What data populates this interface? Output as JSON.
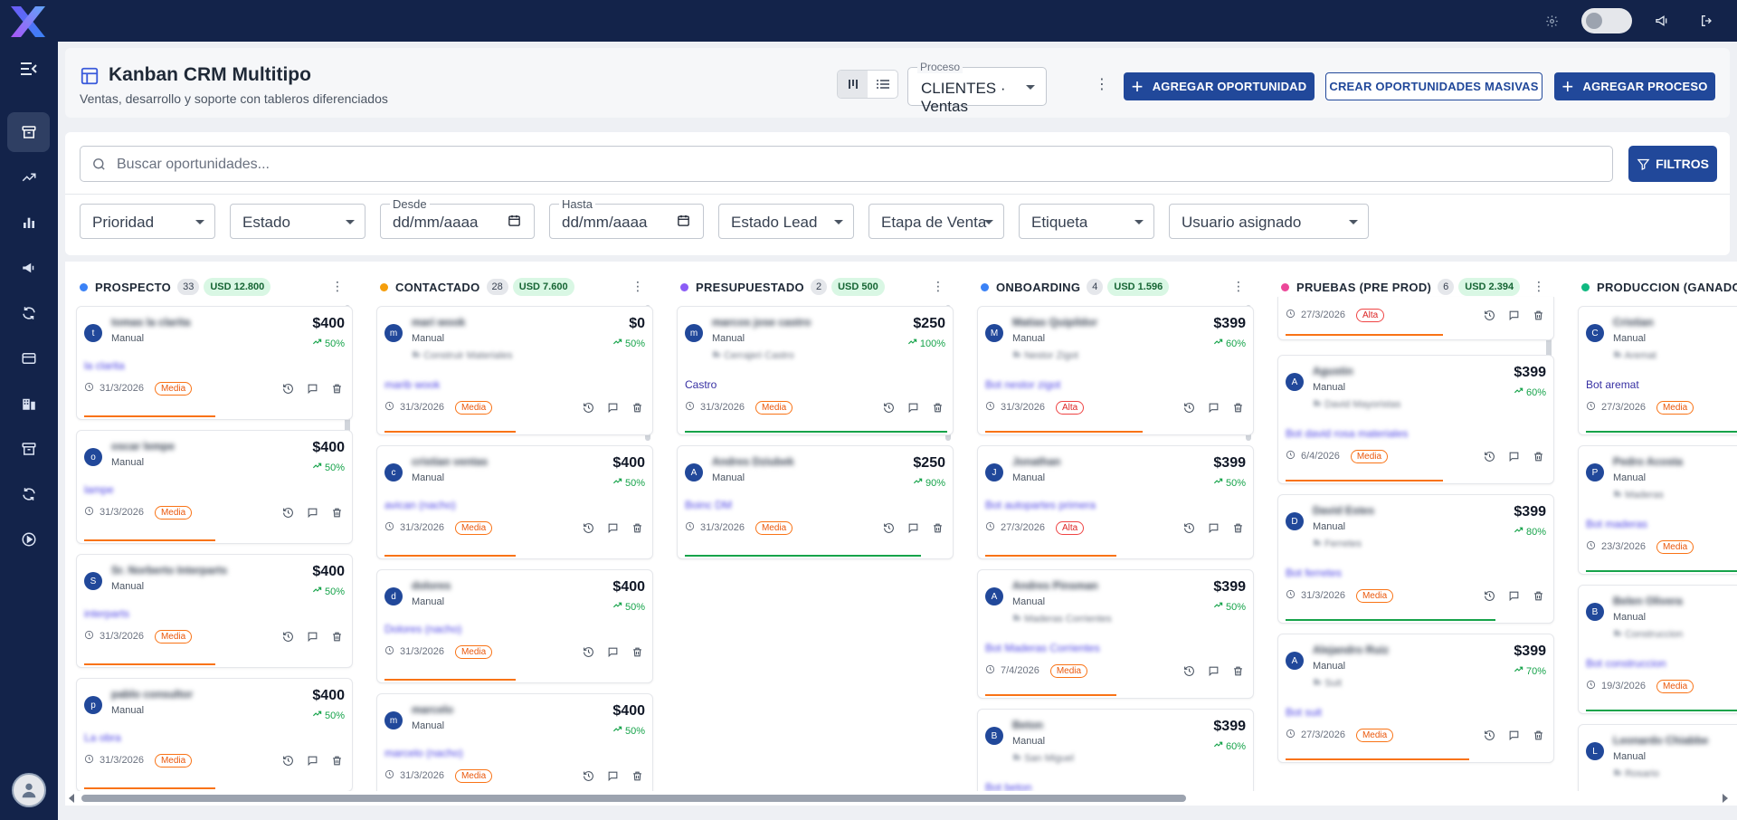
{
  "header": {
    "title": "Kanban CRM Multitipo",
    "subtitle": "Ventas, desarrollo y soporte con tableros diferenciados",
    "process_label": "Proceso",
    "process_value": "CLIENTES · Ventas",
    "add_opportunity": "AGREGAR OPORTUNIDAD",
    "bulk_create": "CREAR OPORTUNIDADES MASIVAS",
    "add_process": "AGREGAR PROCESO"
  },
  "search": {
    "placeholder": "Buscar oportunidades...",
    "filters_label": "FILTROS"
  },
  "filters": {
    "prioridad": "Prioridad",
    "estado": "Estado",
    "desde_label": "Desde",
    "desde_value": "dd/mm/aaaa",
    "hasta_label": "Hasta",
    "hasta_value": "dd/mm/aaaa",
    "estado_lead": "Estado Lead",
    "etapa_venta": "Etapa de Venta",
    "etiqueta": "Etiqueta",
    "usuario": "Usuario asignado"
  },
  "colors": {
    "primary": "#21489a",
    "navy": "#13234a",
    "media": "#ea580c",
    "alta": "#dc2626",
    "success": "#16a34a"
  },
  "columns": [
    {
      "name": "PROSPECTO",
      "count": "33",
      "usd": "USD 12.800",
      "color": "#3b82f6",
      "cards": [
        {
          "initial": "t",
          "name": "tomas la clarita",
          "source": "Manual",
          "amount": "$400",
          "prob": "50%",
          "bot": "la clarita",
          "date": "31/3/2026",
          "priority": "Media",
          "bar_pct": 0.5,
          "bar_color": "#f97316",
          "company": ""
        },
        {
          "initial": "o",
          "name": "oscar lempe",
          "source": "Manual",
          "amount": "$400",
          "prob": "50%",
          "bot": "lampe",
          "date": "31/3/2026",
          "priority": "Media",
          "bar_pct": 0.5,
          "bar_color": "#f97316",
          "company": ""
        },
        {
          "initial": "S",
          "name": "Sr. Norberto Interparts",
          "source": "Manual",
          "amount": "$400",
          "prob": "50%",
          "bot": "interparts",
          "date": "31/3/2026",
          "priority": "Media",
          "bar_pct": 0.5,
          "bar_color": "#f97316",
          "company": ""
        },
        {
          "initial": "p",
          "name": "pablo consultor",
          "source": "Manual",
          "amount": "$400",
          "prob": "50%",
          "bot": "La obra",
          "date": "31/3/2026",
          "priority": "Media",
          "bar_pct": 0.5,
          "bar_color": "#f97316",
          "company": ""
        }
      ]
    },
    {
      "name": "CONTACTADO",
      "count": "28",
      "usd": "USD 7.600",
      "color": "#f59e0b",
      "cards": [
        {
          "initial": "m",
          "name": "mari wook",
          "source": "Manual",
          "amount": "$0",
          "prob": "50%",
          "bot": "marib wook",
          "date": "31/3/2026",
          "priority": "Media",
          "bar_pct": 0.5,
          "bar_color": "#f97316",
          "company": "Construir Materiales"
        },
        {
          "initial": "c",
          "name": "cristian ventas",
          "source": "Manual",
          "amount": "$400",
          "prob": "50%",
          "bot": "avican (nacho)",
          "date": "31/3/2026",
          "priority": "Media",
          "bar_pct": 0.5,
          "bar_color": "#f97316",
          "company": ""
        },
        {
          "initial": "d",
          "name": "dolores",
          "source": "Manual",
          "amount": "$400",
          "prob": "50%",
          "bot": "Dolores (nacho)",
          "date": "31/3/2026",
          "priority": "Media",
          "bar_pct": 0.5,
          "bar_color": "#f97316",
          "company": ""
        },
        {
          "initial": "m",
          "name": "marcelo",
          "source": "Manual",
          "amount": "$400",
          "prob": "50%",
          "bot": "marcelo (nacho)",
          "date": "31/3/2026",
          "priority": "Media",
          "bar_pct": 0.5,
          "bar_color": "#f97316",
          "company": ""
        }
      ]
    },
    {
      "name": "PRESUPUESTADO",
      "count": "2",
      "usd": "USD 500",
      "color": "#8b5cf6",
      "cards": [
        {
          "initial": "m",
          "name": "marcos jose castro",
          "source": "Manual",
          "amount": "$250",
          "prob": "100%",
          "bot": "Castro",
          "bot_clear": true,
          "date": "31/3/2026",
          "priority": "Media",
          "bar_pct": 1.0,
          "bar_color": "#16a34a",
          "company": "Cerrajeri Castro"
        },
        {
          "initial": "A",
          "name": "Andres Dziubek",
          "source": "Manual",
          "amount": "$250",
          "prob": "90%",
          "bot": "Boinc DM",
          "date": "31/3/2026",
          "priority": "Media",
          "bar_pct": 0.9,
          "bar_color": "#16a34a",
          "company": ""
        }
      ]
    },
    {
      "name": "ONBOARDING",
      "count": "4",
      "usd": "USD 1.596",
      "color": "#3b82f6",
      "cards": [
        {
          "initial": "M",
          "name": "Matias Quipildor",
          "source": "Manual",
          "amount": "$399",
          "prob": "60%",
          "bot": "Bot nestor zigot",
          "date": "31/3/2026",
          "priority": "Alta",
          "bar_pct": 0.6,
          "bar_color": "#f97316",
          "company": "Nestor Zigot"
        },
        {
          "initial": "J",
          "name": "Jonathan",
          "source": "Manual",
          "amount": "$399",
          "prob": "50%",
          "bot": "Bot autopartes primera",
          "date": "27/3/2026",
          "priority": "Alta",
          "bar_pct": 0.5,
          "bar_color": "#f97316",
          "company": ""
        },
        {
          "initial": "A",
          "name": "Andres Pinsman",
          "source": "Manual",
          "amount": "$399",
          "prob": "50%",
          "bot": "Bot Maderas Corrientes",
          "date": "7/4/2026",
          "priority": "Media",
          "bar_pct": 0.5,
          "bar_color": "#f97316",
          "company": "Maderas Corrientes"
        },
        {
          "initial": "B",
          "name": "Beton",
          "source": "Manual",
          "amount": "$399",
          "prob": "60%",
          "bot": "Bot beton",
          "date": "",
          "priority": "",
          "bar_pct": 0,
          "bar_color": "#f97316",
          "company": "San Miguel"
        }
      ]
    },
    {
      "name": "PRUEBAS (PRE PROD)",
      "count": "6",
      "usd": "USD 2.394",
      "color": "#ec4899",
      "cards": [
        {
          "initial": "",
          "name": "",
          "source": "",
          "amount": "",
          "prob": "",
          "bot": "",
          "date": "27/3/2026",
          "priority": "Alta",
          "bar_pct": 0.6,
          "bar_color": "#f97316",
          "company": "",
          "partial": true
        },
        {
          "initial": "A",
          "name": "Agustin",
          "source": "Manual",
          "amount": "$399",
          "prob": "60%",
          "bot": "Bot david rosa materiales",
          "date": "6/4/2026",
          "priority": "Media",
          "bar_pct": 0.6,
          "bar_color": "#f97316",
          "company": "David Mayoristas"
        },
        {
          "initial": "D",
          "name": "David Estes",
          "source": "Manual",
          "amount": "$399",
          "prob": "80%",
          "bot": "Bot ferretes",
          "date": "31/3/2026",
          "priority": "Media",
          "bar_pct": 0.8,
          "bar_color": "#16a34a",
          "company": "Ferretes"
        },
        {
          "initial": "A",
          "name": "Alejandro Ruiz",
          "source": "Manual",
          "amount": "$399",
          "prob": "70%",
          "bot": "Bot suit",
          "date": "27/3/2026",
          "priority": "Media",
          "bar_pct": 0.7,
          "bar_color": "#f97316",
          "company": "Suit"
        }
      ]
    },
    {
      "name": "PRODUCCION (GANADO)",
      "count": "",
      "usd": "",
      "color": "#10b981",
      "cards": [
        {
          "initial": "C",
          "name": "Cristian",
          "source": "Manual",
          "amount": "",
          "prob": "",
          "bot": "Bot aremat",
          "bot_clear": true,
          "date": "27/3/2026",
          "priority": "Media",
          "bar_pct": 1.0,
          "bar_color": "#16a34a",
          "company": "Aremat"
        },
        {
          "initial": "P",
          "name": "Pedro Acosta",
          "source": "Manual",
          "amount": "",
          "prob": "",
          "bot": "Bot maderas",
          "date": "23/3/2026",
          "priority": "Media",
          "bar_pct": 1.0,
          "bar_color": "#16a34a",
          "company": "Maderas"
        },
        {
          "initial": "B",
          "name": "Belen Olivera",
          "source": "Manual",
          "amount": "",
          "prob": "",
          "bot": "Bot construccion",
          "date": "19/3/2026",
          "priority": "Media",
          "bar_pct": 1.0,
          "bar_color": "#16a34a",
          "company": "Construccion"
        },
        {
          "initial": "L",
          "name": "Leonardo Chiabbe",
          "source": "Manual",
          "amount": "",
          "prob": "",
          "bot": "",
          "date": "",
          "priority": "",
          "bar_pct": 0,
          "bar_color": "#16a34a",
          "company": "Rosario"
        }
      ]
    }
  ]
}
